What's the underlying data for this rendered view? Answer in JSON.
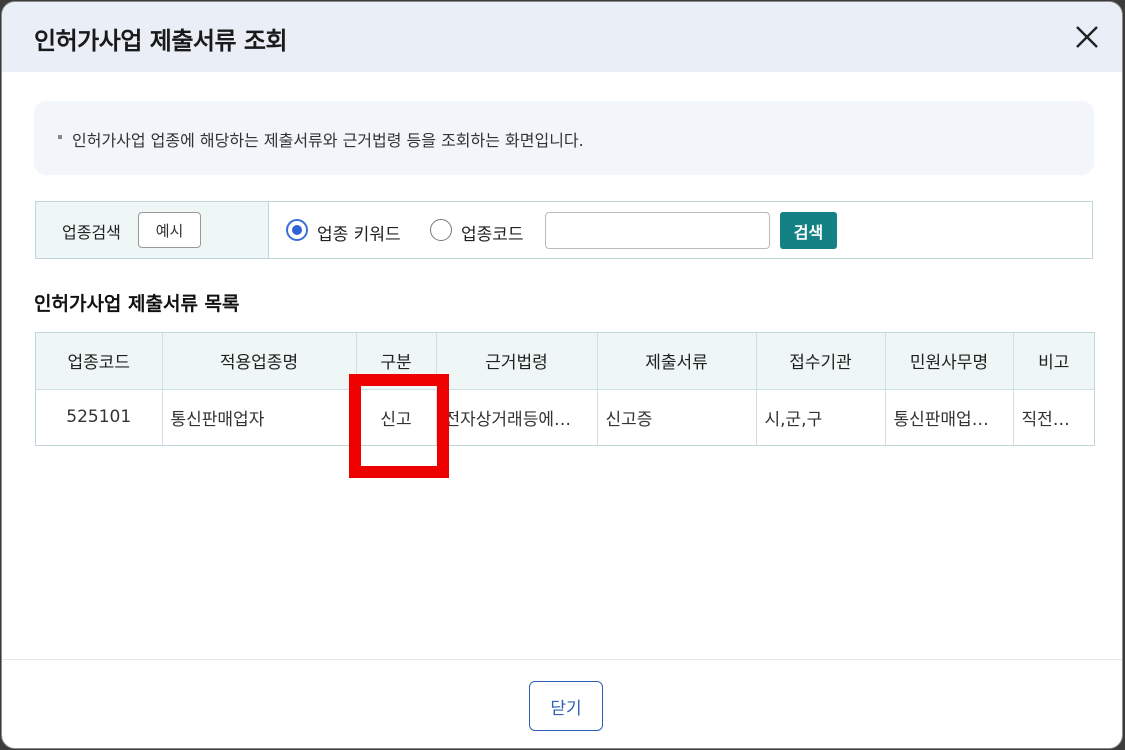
{
  "dialog": {
    "title": "인허가사업 제출서류 조회",
    "info_text": "인허가사업 업종에 해당하는 제출서류와 근거법령 등을 조회하는 화면입니다."
  },
  "search": {
    "label": "업종검색",
    "example_button": "예시",
    "radio_keyword": "업종 키워드",
    "radio_code": "업종코드",
    "selected": "업종 키워드",
    "input_value": "",
    "search_button": "검색"
  },
  "list": {
    "title": "인허가사업 제출서류 목록",
    "columns": [
      "업종코드",
      "적용업종명",
      "구분",
      "근거법령",
      "제출서류",
      "접수기관",
      "민원사무명",
      "비고"
    ],
    "rows": [
      [
        "525101",
        "통신판매업자",
        "신고",
        "전자상거래등에…",
        "신고증",
        "시,군,구",
        "통신판매업…",
        "직전…"
      ]
    ]
  },
  "footer": {
    "close_button": "닫기"
  },
  "colors": {
    "header_bg": "#e9eef7",
    "accent_teal": "#148185",
    "highlight_red": "#ee0000",
    "radio_blue": "#2f63d6"
  }
}
